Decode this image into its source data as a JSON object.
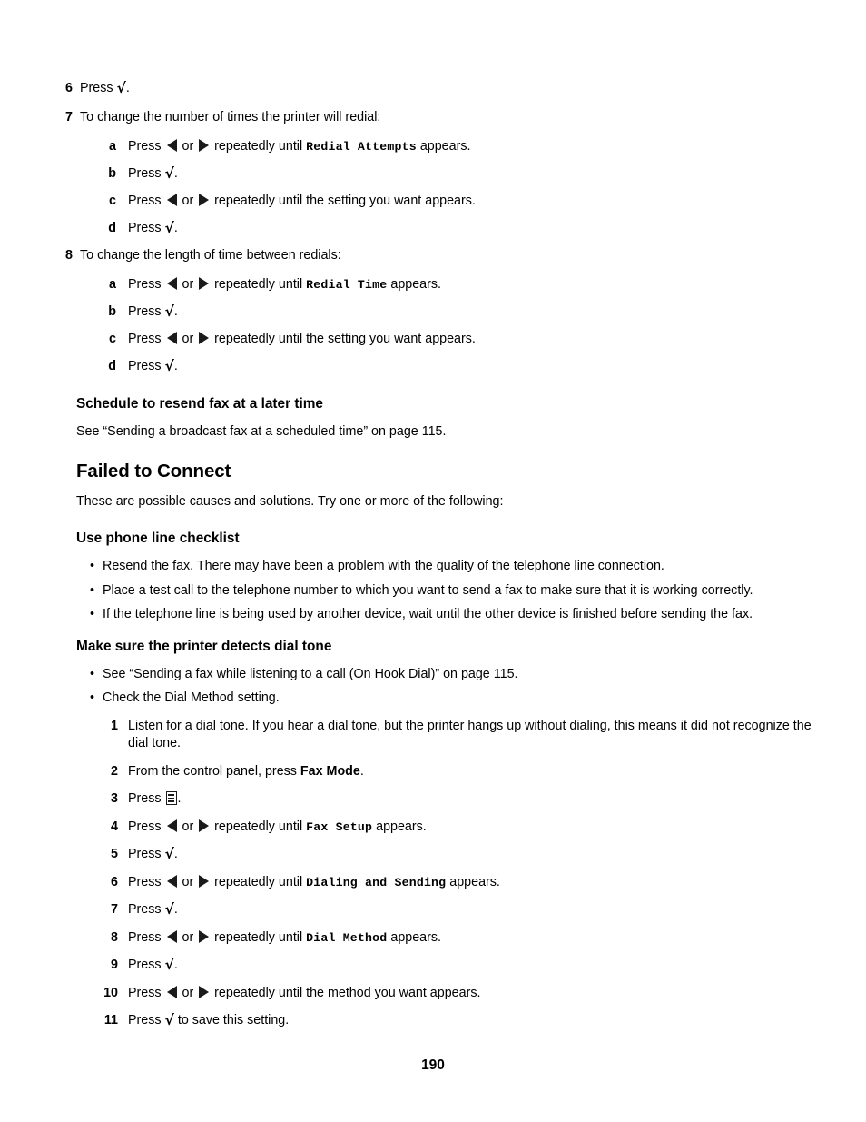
{
  "document": {
    "page_number": "190"
  },
  "glyphs": {
    "check": "√",
    "left_arrow": "left-arrow-triangle",
    "right_arrow": "right-arrow-triangle",
    "menu": "menu-icon",
    "bullet": "•"
  },
  "steps_top": [
    {
      "num": "6",
      "text_before": "Press ",
      "glyph": "check",
      "text_after": "."
    },
    {
      "num": "7",
      "text": "To change the number of times the printer will redial:",
      "substeps": [
        {
          "letter": "a",
          "pre": "Press ",
          "mid": " or ",
          "post": " repeatedly until ",
          "display": "Redial Attempts",
          "tail": " appears."
        },
        {
          "letter": "b",
          "pre": "Press ",
          "tail": "."
        },
        {
          "letter": "c",
          "pre": "Press ",
          "mid": " or ",
          "post": " repeatedly until the setting you want appears."
        },
        {
          "letter": "d",
          "pre": "Press ",
          "tail": "."
        }
      ]
    },
    {
      "num": "8",
      "text": "To change the length of time between redials:",
      "substeps": [
        {
          "letter": "a",
          "pre": "Press ",
          "mid": " or ",
          "post": " repeatedly until ",
          "display": "Redial Time",
          "tail": " appears."
        },
        {
          "letter": "b",
          "pre": "Press ",
          "tail": "."
        },
        {
          "letter": "c",
          "pre": "Press ",
          "mid": " or ",
          "post": " repeatedly until the setting you want appears."
        },
        {
          "letter": "d",
          "pre": "Press ",
          "tail": "."
        }
      ]
    }
  ],
  "section_schedule": {
    "heading": "Schedule to resend fax at a later time",
    "paragraph": "See “Sending a broadcast fax at a scheduled time” on page 115."
  },
  "section_failed": {
    "heading": "Failed to Connect",
    "intro": "These are possible causes and solutions. Try one or more of the following:"
  },
  "section_phone_checklist": {
    "heading": "Use phone line checklist",
    "bullets": [
      "Resend the fax. There may have been a problem with the quality of the telephone line connection.",
      "Place a test call to the telephone number to which you want to send a fax to make sure that it is working correctly.",
      "If the telephone line is being used by another device, wait until the other device is finished before sending the fax."
    ]
  },
  "section_dial_tone": {
    "heading": "Make sure the printer detects dial tone",
    "bullets": [
      "See “Sending a fax while listening to a call (On Hook Dial)” on page 115.",
      "Check the Dial Method setting."
    ],
    "steps": [
      {
        "num": "1",
        "text": "Listen for a dial tone. If you hear a dial tone, but the printer hangs up without dialing, this means it did not recognize the dial tone."
      },
      {
        "num": "2",
        "pre": "From the control panel, press ",
        "bold": "Fax Mode",
        "tail": "."
      },
      {
        "num": "3",
        "pre": "Press ",
        "glyph": "menu",
        "tail": "."
      },
      {
        "num": "4",
        "pre": "Press ",
        "mid": " or ",
        "post": " repeatedly until ",
        "display": "Fax Setup",
        "tail": " appears."
      },
      {
        "num": "5",
        "pre": "Press ",
        "glyph": "check",
        "tail": "."
      },
      {
        "num": "6",
        "pre": "Press ",
        "mid": " or ",
        "post": " repeatedly until ",
        "display": "Dialing and Sending",
        "tail": " appears."
      },
      {
        "num": "7",
        "pre": "Press ",
        "glyph": "check",
        "tail": "."
      },
      {
        "num": "8",
        "pre": "Press ",
        "mid": " or ",
        "post": " repeatedly until ",
        "display": "Dial Method",
        "tail": " appears."
      },
      {
        "num": "9",
        "pre": "Press ",
        "glyph": "check",
        "tail": "."
      },
      {
        "num": "10",
        "pre": "Press ",
        "mid": " or ",
        "post": " repeatedly until the method you want appears."
      },
      {
        "num": "11",
        "pre": "Press ",
        "glyph": "check",
        "tail": " to save this setting."
      }
    ]
  }
}
